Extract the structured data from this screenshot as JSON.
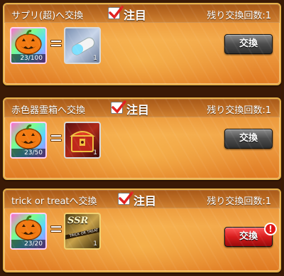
{
  "exchanges": [
    {
      "title": "サプリ(超)へ交換",
      "attention_label": "注目",
      "remaining": "残り交換回数:1",
      "source_count": "23/100",
      "reward_qty": "1",
      "button_label": "交換",
      "source_icon": "pumpkin-icon",
      "reward_icon": "supplement-icon"
    },
    {
      "title": "赤色器霊箱へ交換",
      "attention_label": "注目",
      "remaining": "残り交換回数:1",
      "source_count": "23/50",
      "reward_qty": "1",
      "button_label": "交換",
      "source_icon": "pumpkin-icon",
      "reward_icon": "treasure-box-icon"
    },
    {
      "title": "trick or treatへ交換",
      "attention_label": "注目",
      "remaining": "残り交換回数:1",
      "source_count": "23/20",
      "reward_qty": "1",
      "reward_card_text": "SSR",
      "reward_card_banner": "TRICK OR TREAT",
      "button_label": "交換",
      "alert": "!",
      "source_icon": "pumpkin-icon",
      "reward_icon": "ssr-card-icon"
    }
  ],
  "colors": {
    "panel": "#f2a64a",
    "button_gray": "#4c4c4c",
    "button_red": "#d81d1d",
    "check_red": "#e02020"
  }
}
